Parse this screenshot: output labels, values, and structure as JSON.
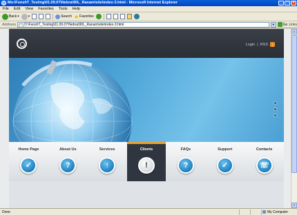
{
  "window": {
    "title": "Mo:\\FunshT_Testing\\01.09.07\\Nebra\\90L_Ranam\\site\\index-3.html - Microsoft Internet Explorer",
    "buttons": [
      "_",
      "□",
      "×"
    ]
  },
  "menu": [
    "File",
    "Edit",
    "View",
    "Favorites",
    "Tools",
    "Help"
  ],
  "toolbar": {
    "back": "Back",
    "search": "Search",
    "favorites": "Favorites"
  },
  "address": {
    "label": "Address",
    "value": "D:\\FunshT_Testing\\01.09.07\\Nebra\\90L_Ranam\\site\\index-3.html",
    "go": "Go",
    "links": "Links"
  },
  "header": {
    "login": "Login",
    "separator": "|",
    "rss": "RSS"
  },
  "nav": [
    {
      "label": "Home Page",
      "glyph": "✓",
      "active": false
    },
    {
      "label": "About Us",
      "glyph": "?",
      "active": false
    },
    {
      "label": "Services",
      "glyph": "↑",
      "active": false
    },
    {
      "label": "Clients",
      "glyph": "!",
      "active": true
    },
    {
      "label": "FAQs",
      "glyph": "?",
      "active": false
    },
    {
      "label": "Support",
      "glyph": "✓",
      "active": false
    },
    {
      "label": "Contacts",
      "glyph": "☏",
      "active": false
    }
  ],
  "status": {
    "left": "Done",
    "zone": "My Computer"
  }
}
